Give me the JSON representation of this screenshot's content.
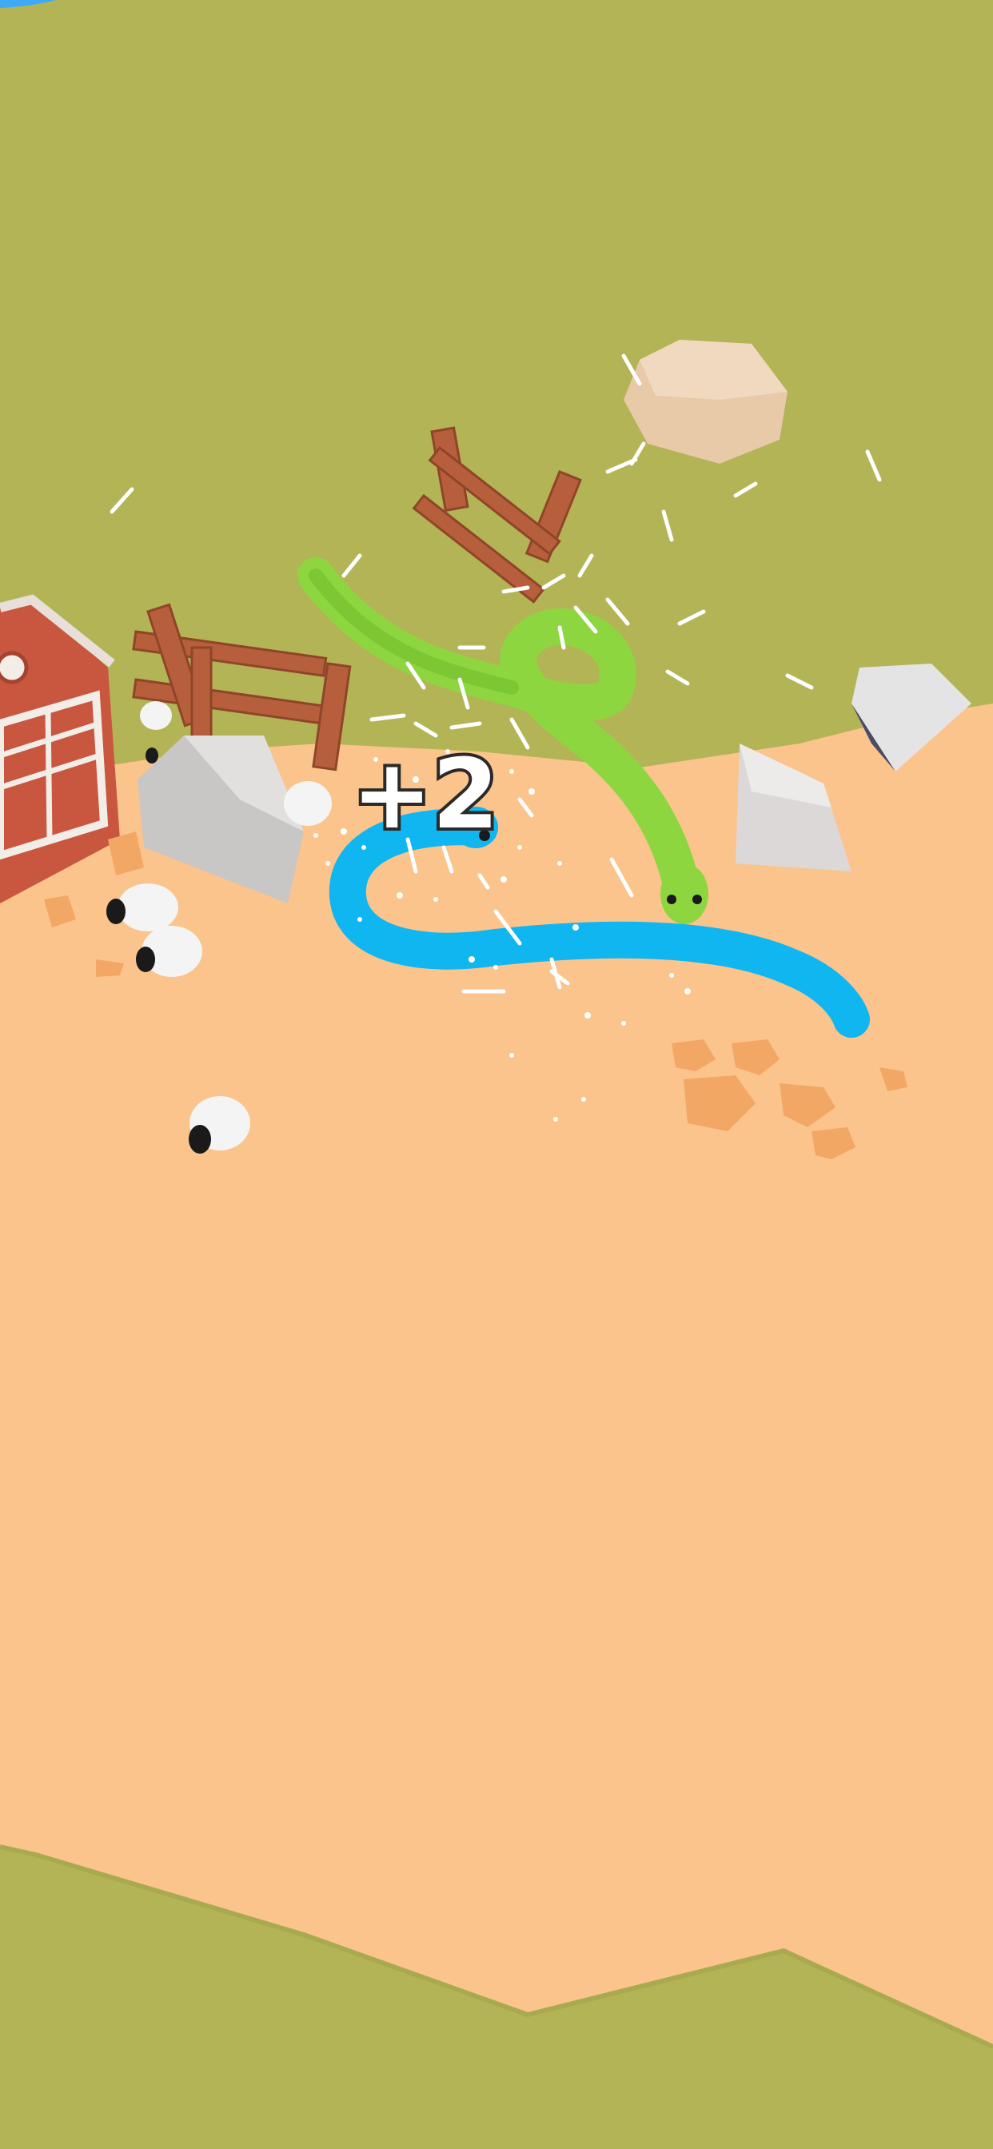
{
  "hud": {
    "score_popup": "+2"
  },
  "colors": {
    "grass": "#b3b455",
    "sand": "#fbc48c",
    "player_snake": "#10b6ef",
    "enemy_snake": "#8ed63f",
    "rock_gray": "#c9c6c6",
    "rock_tan": "#e8c9a8",
    "fence": "#b75f3c",
    "barn_red": "#c9563f",
    "bone": "#ffffff"
  },
  "entities": {
    "player_snake_icon": "snake-icon",
    "enemy_snake_icon": "snake-icon",
    "sheep_icon": "sheep-icon",
    "bone_icon": "bone-icon",
    "rock_icon": "rock-icon",
    "fence_icon": "fence-icon",
    "barn_icon": "barn-icon"
  }
}
